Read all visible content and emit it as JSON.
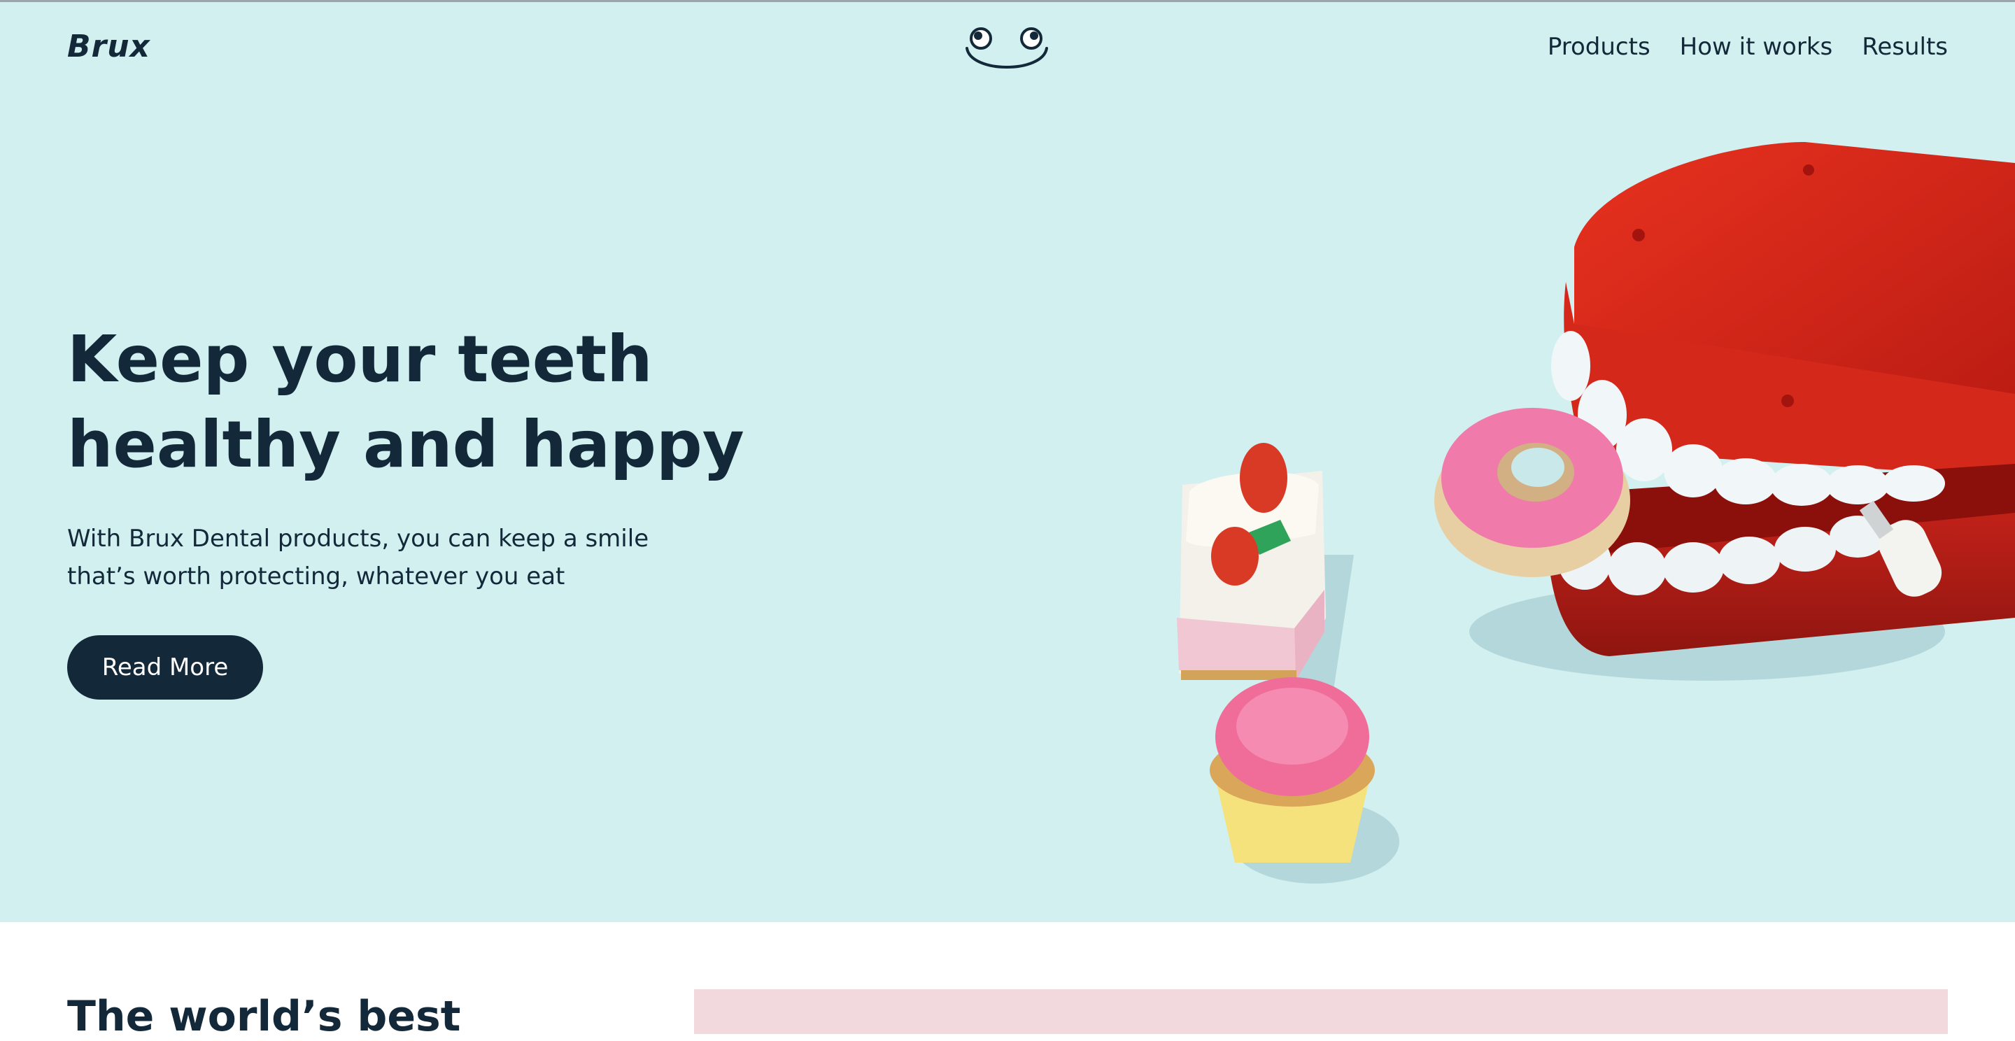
{
  "header": {
    "logo": "Brux",
    "nav": [
      "Products",
      "How it works",
      "Results"
    ]
  },
  "hero": {
    "title": "Keep your teeth healthy and happy",
    "subtitle": "With Brux Dental products, you can keep a smile that’s worth protecting, whatever you eat",
    "cta": "Read More",
    "image": {
      "subject": "wind-up chattering teeth toy biting a pink donut, strawberry cake slice and pink cupcake toys",
      "bg_color": "#d2f0f0"
    }
  },
  "section2": {
    "title": "The world’s best"
  },
  "colors": {
    "primary": "#13293a",
    "hero_bg": "#d2f0f0",
    "accent_pink": "#f1d9de",
    "toy_red": "#d42a1c"
  },
  "icons": [
    "smiley-face-icon"
  ]
}
